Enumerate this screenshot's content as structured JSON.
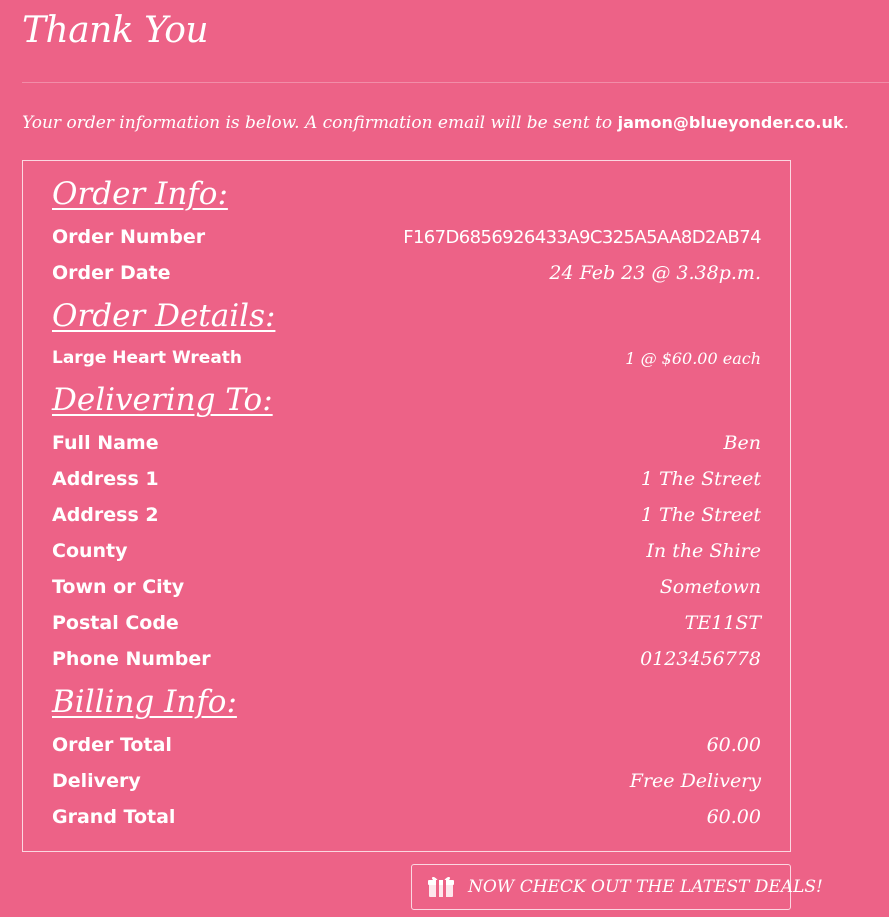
{
  "header": {
    "title": "Thank You"
  },
  "intro": {
    "text": "Your order information is below. A confirmation email will be sent to ",
    "email": "jamon@blueyonder.co.uk",
    "suffix": "."
  },
  "order_info": {
    "heading": "Order Info:",
    "order_number_label": "Order Number",
    "order_number": "F167D6856926433A9C325A5AA8D2AB74",
    "order_date_label": "Order Date",
    "order_date": "24 Feb 23 @ 3.38p.m."
  },
  "order_details": {
    "heading": "Order Details:",
    "items": [
      {
        "name": "Large Heart Wreath",
        "quantity_price": "1 @ $60.00 each"
      }
    ]
  },
  "delivering_to": {
    "heading": "Delivering To:",
    "fields": [
      {
        "label": "Full Name",
        "value": "Ben"
      },
      {
        "label": "Address 1",
        "value": "1 The Street"
      },
      {
        "label": "Address 2",
        "value": "1 The Street"
      },
      {
        "label": "County",
        "value": "In the Shire"
      },
      {
        "label": "Town or City",
        "value": "Sometown"
      },
      {
        "label": "Postal Code",
        "value": "TE11ST"
      },
      {
        "label": "Phone Number",
        "value": "0123456778"
      }
    ]
  },
  "billing_info": {
    "heading": "Billing Info:",
    "fields": [
      {
        "label": "Order Total",
        "value": "60.00"
      },
      {
        "label": "Delivery",
        "value": "Free Delivery"
      },
      {
        "label": "Grand Total",
        "value": "60.00"
      }
    ]
  },
  "cta": {
    "icon": "gift-icon",
    "label": "NOW CHECK OUT THE LATEST DEALS!"
  },
  "colors": {
    "background": "#ed6287",
    "text": "#ffffff"
  }
}
